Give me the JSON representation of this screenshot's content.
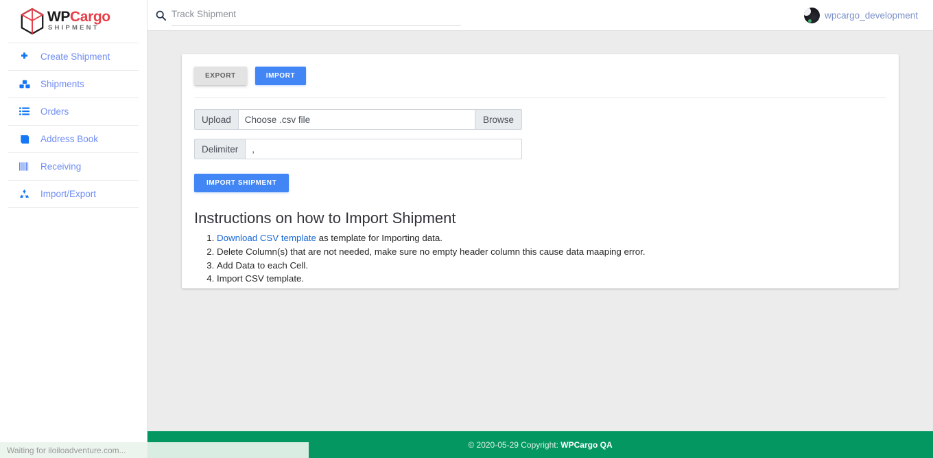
{
  "brand": {
    "logo_wp": "WP",
    "logo_cargo": "Cargo",
    "logo_sub": "SHIPMENT",
    "logo_icon": "cube-box-icon",
    "accent_red": "#e8404a",
    "accent_blue": "#4285f4",
    "footer_green": "#049761"
  },
  "sidebar": {
    "items": [
      {
        "label": "Create Shipment",
        "icon": "plus-icon"
      },
      {
        "label": "Shipments",
        "icon": "boxes-icon"
      },
      {
        "label": "Orders",
        "icon": "list-icon"
      },
      {
        "label": "Address Book",
        "icon": "book-icon"
      },
      {
        "label": "Receiving",
        "icon": "barcode-icon"
      },
      {
        "label": "Import/Export",
        "icon": "recycle-icon"
      }
    ]
  },
  "header": {
    "search": {
      "placeholder": "Track Shipment",
      "value": "",
      "icon": "search-icon"
    },
    "user": {
      "name": "wpcargo_development",
      "avatar_icon": "avatar-icon"
    }
  },
  "main": {
    "toolbar": {
      "export_label": "EXPORT",
      "import_label": "IMPORT"
    },
    "form": {
      "upload_label": "Upload",
      "upload_placeholder": "Choose .csv file",
      "upload_value": "",
      "browse_label": "Browse",
      "delimiter_label": "Delimiter",
      "delimiter_value": ",",
      "submit_label": "IMPORT SHIPMENT"
    },
    "instructions": {
      "title": "Instructions on how to Import Shipment",
      "items": [
        {
          "link": "Download CSV template",
          "text": " as template for Importing data."
        },
        {
          "link": "",
          "text": "Delete Column(s) that are not needed, make sure no empty header column this cause data maaping error."
        },
        {
          "link": "",
          "text": "Add Data to each Cell."
        },
        {
          "link": "",
          "text": "Import CSV template."
        }
      ]
    }
  },
  "footer": {
    "copyright_prefix": "© 2020-05-29 Copyright: ",
    "copyright_name": "WPCargo QA"
  },
  "browser": {
    "status_text": "Waiting for iloiloadventure.com..."
  }
}
